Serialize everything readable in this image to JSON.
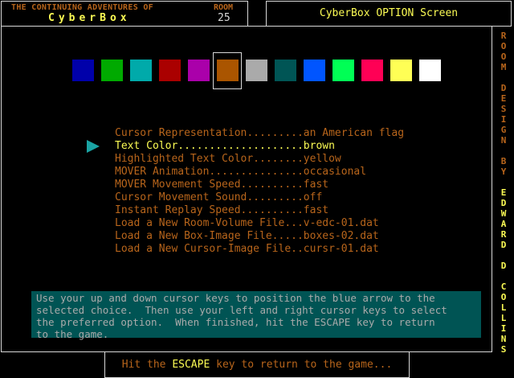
{
  "header": {
    "adventures": "THE CONTINUING ADVENTURES OF",
    "game": "CyberBox",
    "room_label": "ROOM",
    "room_number": "25",
    "screen_title": "CyberBox OPTION Screen"
  },
  "swatches": [
    "#0000aa",
    "#00aa00",
    "#00aaaa",
    "#aa0000",
    "#aa00aa",
    "#aa5500",
    "#aaaaaa",
    "#005555",
    "#0055ff",
    "#00ff55",
    "#ff0055",
    "#ffff55",
    "#ffffff"
  ],
  "selected_swatch_index": 5,
  "menu": [
    {
      "text": "Cursor Representation.........an American flag"
    },
    {
      "text": "Text Color....................brown"
    },
    {
      "text": "Highlighted Text Color........yellow"
    },
    {
      "text": "MOVER Animation...............occasional"
    },
    {
      "text": "MOVER Movement Speed..........fast"
    },
    {
      "text": "Cursor Movement Sound.........off"
    },
    {
      "text": "Instant Replay Speed..........fast"
    },
    {
      "text": "Load a New Room-Volume File...v-edc-01.dat"
    },
    {
      "text": "Load a New Box-Image File.....boxes-02.dat"
    },
    {
      "text": "Load a New Cursor-Image File..cursr-01.dat"
    }
  ],
  "selected_menu_index": 1,
  "instructions": "Use your up and down cursor keys to position the blue arrow to the\nselected choice.  Then use your left and right cursor keys to select\nthe preferred option.  When finished, hit the ESCAPE key to return\nto the game.",
  "credit": {
    "room_design": "ROOM DESIGN BY",
    "author": "EDWARD D COLLINS"
  },
  "footer": {
    "before": "Hit the ",
    "key": "ESCAPE",
    "after": " key to return to the game..."
  },
  "colors": {
    "text": "#b8651b",
    "highlight": "#fcfc54",
    "panel": "#005454",
    "arrow": "#1aa3a3"
  }
}
